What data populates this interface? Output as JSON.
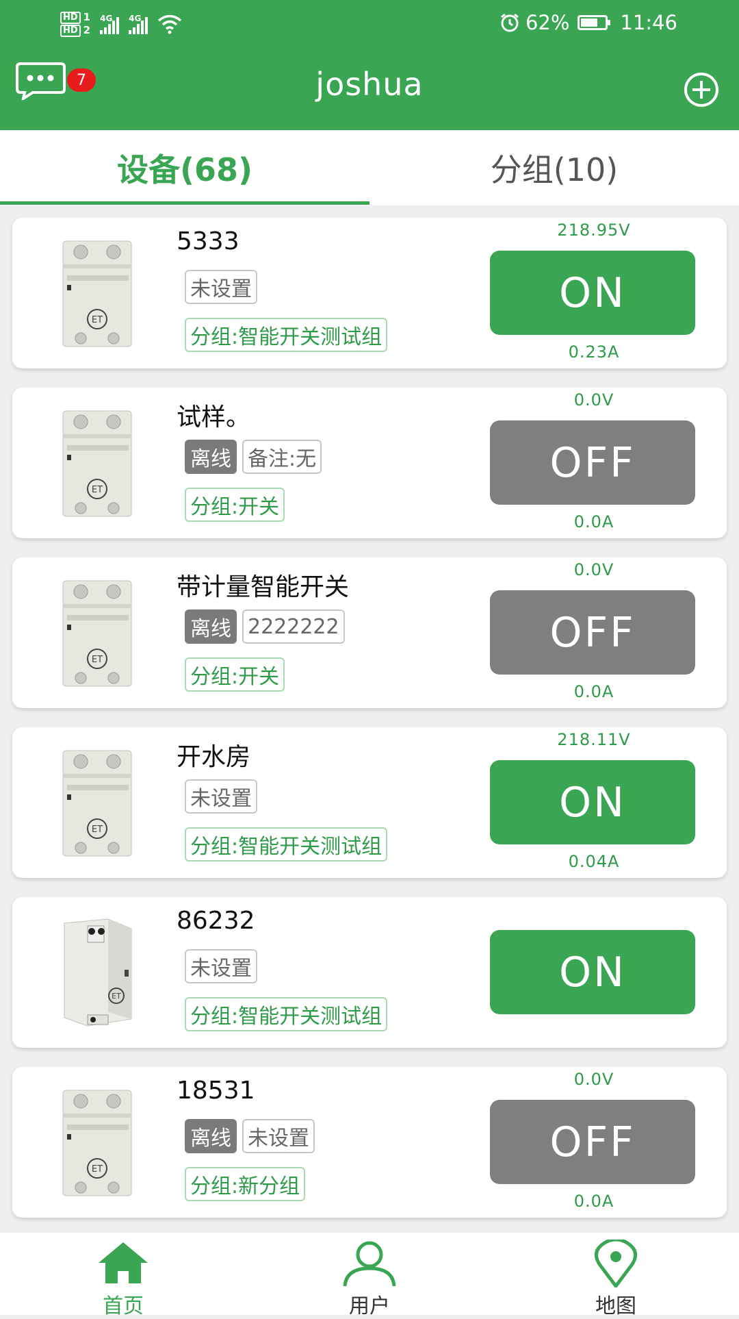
{
  "status_bar": {
    "hd1": "HD",
    "hd1_num": "1",
    "hd2": "HD",
    "hd2_num": "2",
    "net1": "4G",
    "net2": "4G",
    "battery_pct": "62%",
    "time": "11:46",
    "icons": [
      "alarm-icon",
      "wifi-icon",
      "battery-icon"
    ]
  },
  "app_bar": {
    "title": "joshua",
    "message_badge": "7",
    "icons": [
      "message-icon",
      "add-circle-icon"
    ]
  },
  "tabs": [
    {
      "label": "设备(68)",
      "active": true
    },
    {
      "label": "分组(10)",
      "active": false
    }
  ],
  "devices": [
    {
      "name": "5333",
      "chips": [
        {
          "text": "未设置",
          "type": "note"
        }
      ],
      "group": "分组:智能开关测试组",
      "voltage": "218.95V",
      "current": "0.23A",
      "state": "ON",
      "image": "breaker-front"
    },
    {
      "name": "试样。",
      "chips": [
        {
          "text": "离线",
          "type": "offline"
        },
        {
          "text": "备注:无",
          "type": "note"
        }
      ],
      "group": "分组:开关",
      "voltage": "0.0V",
      "current": "0.0A",
      "state": "OFF",
      "image": "breaker-front"
    },
    {
      "name": "带计量智能开关",
      "chips": [
        {
          "text": "离线",
          "type": "offline"
        },
        {
          "text": "2222222",
          "type": "note"
        }
      ],
      "group": "分组:开关",
      "voltage": "0.0V",
      "current": "0.0A",
      "state": "OFF",
      "image": "breaker-front"
    },
    {
      "name": "开水房",
      "chips": [
        {
          "text": "未设置",
          "type": "note"
        }
      ],
      "group": "分组:智能开关测试组",
      "voltage": "218.11V",
      "current": "0.04A",
      "state": "ON",
      "image": "breaker-front"
    },
    {
      "name": "86232",
      "chips": [
        {
          "text": "未设置",
          "type": "note"
        }
      ],
      "group": "分组:智能开关测试组",
      "voltage": "",
      "current": "",
      "state": "ON",
      "image": "breaker-angled"
    },
    {
      "name": "18531",
      "chips": [
        {
          "text": "离线",
          "type": "offline"
        },
        {
          "text": "未设置",
          "type": "note"
        }
      ],
      "group": "分组:新分组",
      "voltage": "0.0V",
      "current": "0.0A",
      "state": "OFF",
      "image": "breaker-front"
    }
  ],
  "bottom_nav": [
    {
      "label": "首页",
      "icon": "home-icon",
      "active": true
    },
    {
      "label": "用户",
      "icon": "user-icon",
      "active": false
    },
    {
      "label": "地图",
      "icon": "map-pin-icon",
      "active": false
    }
  ],
  "colors": {
    "primary": "#3aa653",
    "off_button": "#7f7f7f",
    "offline_chip": "#7a7a7a",
    "badge": "#e81c1c"
  }
}
